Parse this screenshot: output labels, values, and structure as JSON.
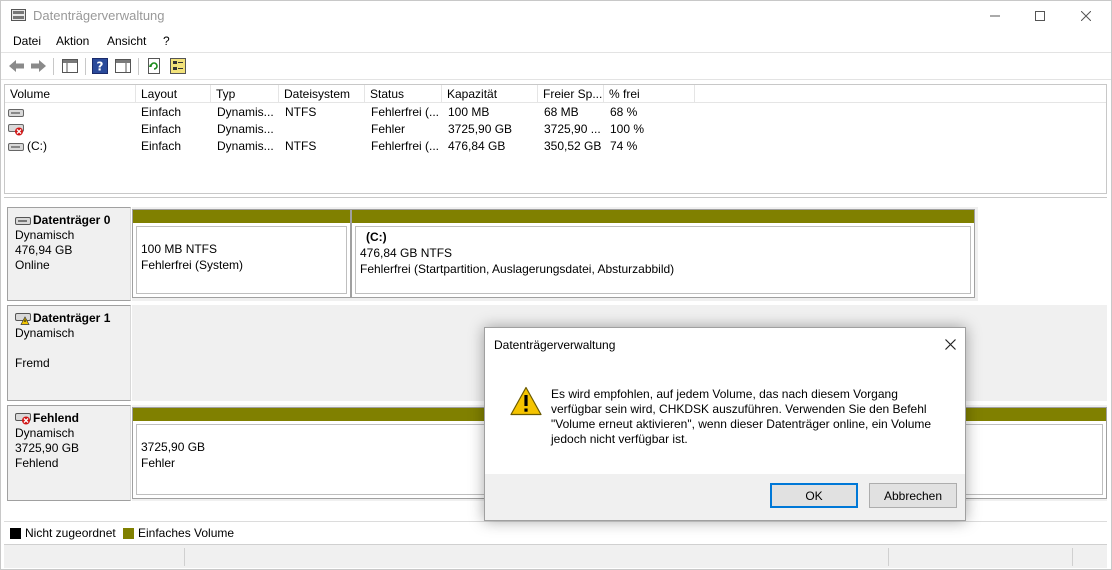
{
  "window": {
    "title": "Datenträgerverwaltung"
  },
  "menu": [
    "Datei",
    "Aktion",
    "Ansicht",
    "?"
  ],
  "columns": [
    "Volume",
    "Layout",
    "Typ",
    "Dateisystem",
    "Status",
    "Kapazität",
    "Freier Sp...",
    "% frei"
  ],
  "volumes": [
    {
      "name": "",
      "layout": "Einfach",
      "typ": "Dynamis...",
      "fs": "NTFS",
      "status": "Fehlerfrei (...",
      "capacity": "100 MB",
      "free": "68 MB",
      "pct": "68 %",
      "icon": "drive-icon"
    },
    {
      "name": "",
      "layout": "Einfach",
      "typ": "Dynamis...",
      "fs": "",
      "status": "Fehler",
      "capacity": "3725,90 GB",
      "free": "3725,90 ...",
      "pct": "100 %",
      "icon": "drive-error-icon"
    },
    {
      "name": "(C:)",
      "layout": "Einfach",
      "typ": "Dynamis...",
      "fs": "NTFS",
      "status": "Fehlerfrei (...",
      "capacity": "476,84 GB",
      "free": "350,52 GB",
      "pct": "74 %",
      "icon": "drive-icon"
    }
  ],
  "disks": [
    {
      "name": "Datenträger 0",
      "type": "Dynamisch",
      "size": "476,94 GB",
      "state": "Online",
      "partitions": [
        {
          "title": "",
          "line1": "100 MB NTFS",
          "line2": "Fehlerfrei (System)"
        },
        {
          "title": "(C:)",
          "line1": "476,84 GB NTFS",
          "line2": "Fehlerfrei (Startpartition, Auslagerungsdatei, Absturzabbild)"
        }
      ]
    },
    {
      "name": "Datenträger 1",
      "type": "Dynamisch",
      "size": "",
      "state": "Fremd",
      "partitions": []
    },
    {
      "name": "Fehlend",
      "type": "Dynamisch",
      "size": "3725,90 GB",
      "state": "Fehlend",
      "partitions": [
        {
          "title": "",
          "line1": "3725,90 GB",
          "line2": "Fehler"
        }
      ]
    }
  ],
  "legend": [
    {
      "label": "Nicht zugeordnet",
      "color": "#000000"
    },
    {
      "label": "Einfaches Volume",
      "color": "#808000"
    }
  ],
  "dialog": {
    "title": "Datenträgerverwaltung",
    "message": "Es wird empfohlen, auf jedem Volume, das nach diesem Vorgang verfügbar sein wird, CHKDSK auszuführen. Verwenden Sie den Befehl \"Volume erneut aktivieren\", wenn dieser Datenträger online, ein Volume jedoch nicht verfügbar ist.",
    "ok": "OK",
    "cancel": "Abbrechen"
  }
}
